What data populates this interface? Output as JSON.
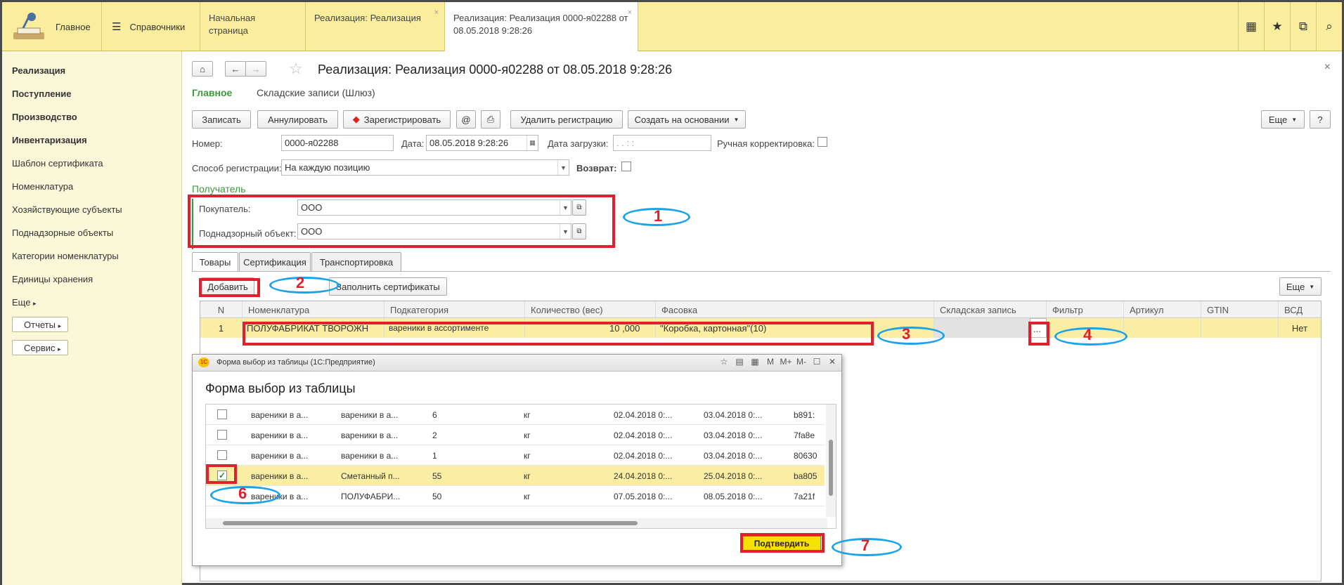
{
  "topbar": {
    "home_label": "Главное",
    "refs_label": "Справочники",
    "tabs": [
      {
        "label": "Начальная страница"
      },
      {
        "label": "Реализация: Реализация"
      },
      {
        "label": "Реализация: Реализация 0000-я02288 от 08.05.2018 9:28:26"
      }
    ],
    "close_glyph": "×"
  },
  "sidebar": {
    "items": [
      {
        "label": "Реализация"
      },
      {
        "label": "Поступление"
      },
      {
        "label": "Производство"
      },
      {
        "label": "Инвентаризация"
      },
      {
        "label": "Шаблон сертификата"
      },
      {
        "label": "Номенклатура"
      },
      {
        "label": "Хозяйствующие субъекты"
      },
      {
        "label": "Поднадзорные объекты"
      },
      {
        "label": "Категории номенклатуры"
      },
      {
        "label": "Единицы хранения"
      },
      {
        "label": "Еще"
      }
    ],
    "buttons": [
      {
        "label": "Отчеты"
      },
      {
        "label": "Сервис"
      }
    ]
  },
  "doc": {
    "title": "Реализация: Реализация 0000-я02288 от 08.05.2018 9:28:26",
    "nav_main": "Главное",
    "nav_records": "Складские записи (Шлюз)",
    "close_glyph": "×",
    "toolbar": {
      "write": "Записать",
      "cancel": "Аннулировать",
      "register": "Зарегистрировать",
      "at": "@",
      "delete_reg": "Удалить регистрацию",
      "create_basis": "Создать на основании",
      "more": "Еще",
      "help": "?"
    },
    "fields": {
      "number_label": "Номер:",
      "number_value": "0000-я02288",
      "date_label": "Дата:",
      "date_value": "08.05.2018  9:28:26",
      "load_date_label": "Дата загрузки:",
      "load_date_value": ".  .      :  :",
      "manual_label": "Ручная корректировка:",
      "reg_method_label": "Способ регистрации:",
      "reg_method_value": "На каждую позицию",
      "return_label": "Возврат:",
      "recipient_group": "Получатель",
      "buyer_label": "Покупатель:",
      "buyer_value": "ООО",
      "object_label": "Поднадзорный объект:",
      "object_value": "ООО"
    },
    "tabs": [
      {
        "label": "Товары"
      },
      {
        "label": "Сертификация"
      },
      {
        "label": "Транспортировка"
      }
    ],
    "goods_toolbar": {
      "add": "Добавить",
      "fill_certs": "Заполнить сертификаты",
      "more": "Еще"
    },
    "grid": {
      "columns": [
        "N",
        "Номенклатура",
        "Подкатегория",
        "Количество (вес)",
        "Фасовка",
        "Складская запись",
        "Фильтр",
        "Артикул",
        "GTIN",
        "ВСД"
      ],
      "rows": [
        {
          "n": "1",
          "nom": "ПОЛУФАБРИКАТ ТВОРОЖН",
          "sub": "вареники в ассортименте",
          "qty": "10  ,000",
          "pack": "\"Коробка, картонная\"(10)",
          "store": "",
          "select": "...",
          "filter": "",
          "art": "",
          "gtin": "",
          "vsd": "Нет"
        }
      ]
    }
  },
  "dialog": {
    "window_title": "Форма выбор из таблицы  (1С:Предприятие)",
    "heading": "Форма выбор из таблицы",
    "title_icons": [
      "M",
      "M+",
      "M-"
    ],
    "rows": [
      {
        "checked": false,
        "c1": "вареники в а...",
        "c2": "вареники в а...",
        "c3": "6",
        "c4": "кг",
        "c5": "02.04.2018 0:...",
        "c6": "03.04.2018 0:...",
        "c7": "b891:"
      },
      {
        "checked": false,
        "c1": "вареники в а...",
        "c2": "вареники в а...",
        "c3": "2",
        "c4": "кг",
        "c5": "02.04.2018 0:...",
        "c6": "03.04.2018 0:...",
        "c7": "7fa8e"
      },
      {
        "checked": false,
        "c1": "вареники в а...",
        "c2": "вареники в а...",
        "c3": "1",
        "c4": "кг",
        "c5": "02.04.2018 0:...",
        "c6": "03.04.2018 0:...",
        "c7": "80630"
      },
      {
        "checked": true,
        "c1": "вареники в а...",
        "c2": "Сметанный п...",
        "c3": "55",
        "c4": "кг",
        "c5": "24.04.2018 0:...",
        "c6": "25.04.2018 0:...",
        "c7": "ba805"
      },
      {
        "checked": false,
        "c1": "вареники в а...",
        "c2": "ПОЛУФАБРИ...",
        "c3": "50",
        "c4": "кг",
        "c5": "07.05.2018 0:...",
        "c6": "08.05.2018 0:...",
        "c7": "7a21f"
      }
    ],
    "confirm": "Подтвердить"
  },
  "annotations": [
    "1",
    "2",
    "3",
    "4",
    "6",
    "7"
  ],
  "colors": {
    "topbar": "#fbed9e",
    "sidebar": "#fbf7d9",
    "selected_row": "#fbeea3",
    "accent_green": "#3a9a3a",
    "red_mark": "#e0202c",
    "blue_mark": "#1aa3e8"
  }
}
